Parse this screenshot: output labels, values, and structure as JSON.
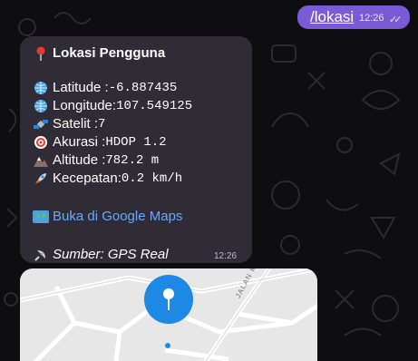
{
  "outgoing": {
    "text": "/lokasi",
    "time": "12:26",
    "status_icon": "double-check-icon"
  },
  "incoming": {
    "title": "Lokasi Pengguna",
    "title_icon": "round-pushpin-icon",
    "latitude_label": "Latitude :",
    "latitude_value": "-6.887435",
    "longitude_label": "Longitude:",
    "longitude_value": "107.549125",
    "satellite_label": "Satelit :",
    "satellite_value": "7",
    "accuracy_label": "Akurasi :",
    "accuracy_value": "HDOP 1.2",
    "altitude_label": "Altitude :",
    "altitude_value": "782.2 m",
    "speed_label": "Kecepatan:",
    "speed_value": "0.2 km/h",
    "maps_link": "Buka di Google Maps",
    "source": "Sumber: GPS Real",
    "time": "12:26"
  },
  "map": {
    "road_name": "JALAN KARYA BHAKTI VII",
    "pin_color": "#1e88e5"
  },
  "colors": {
    "outgoing_bubble": "#7b5ad6",
    "incoming_bubble": "#2f2c36",
    "link": "#67a8ff"
  }
}
